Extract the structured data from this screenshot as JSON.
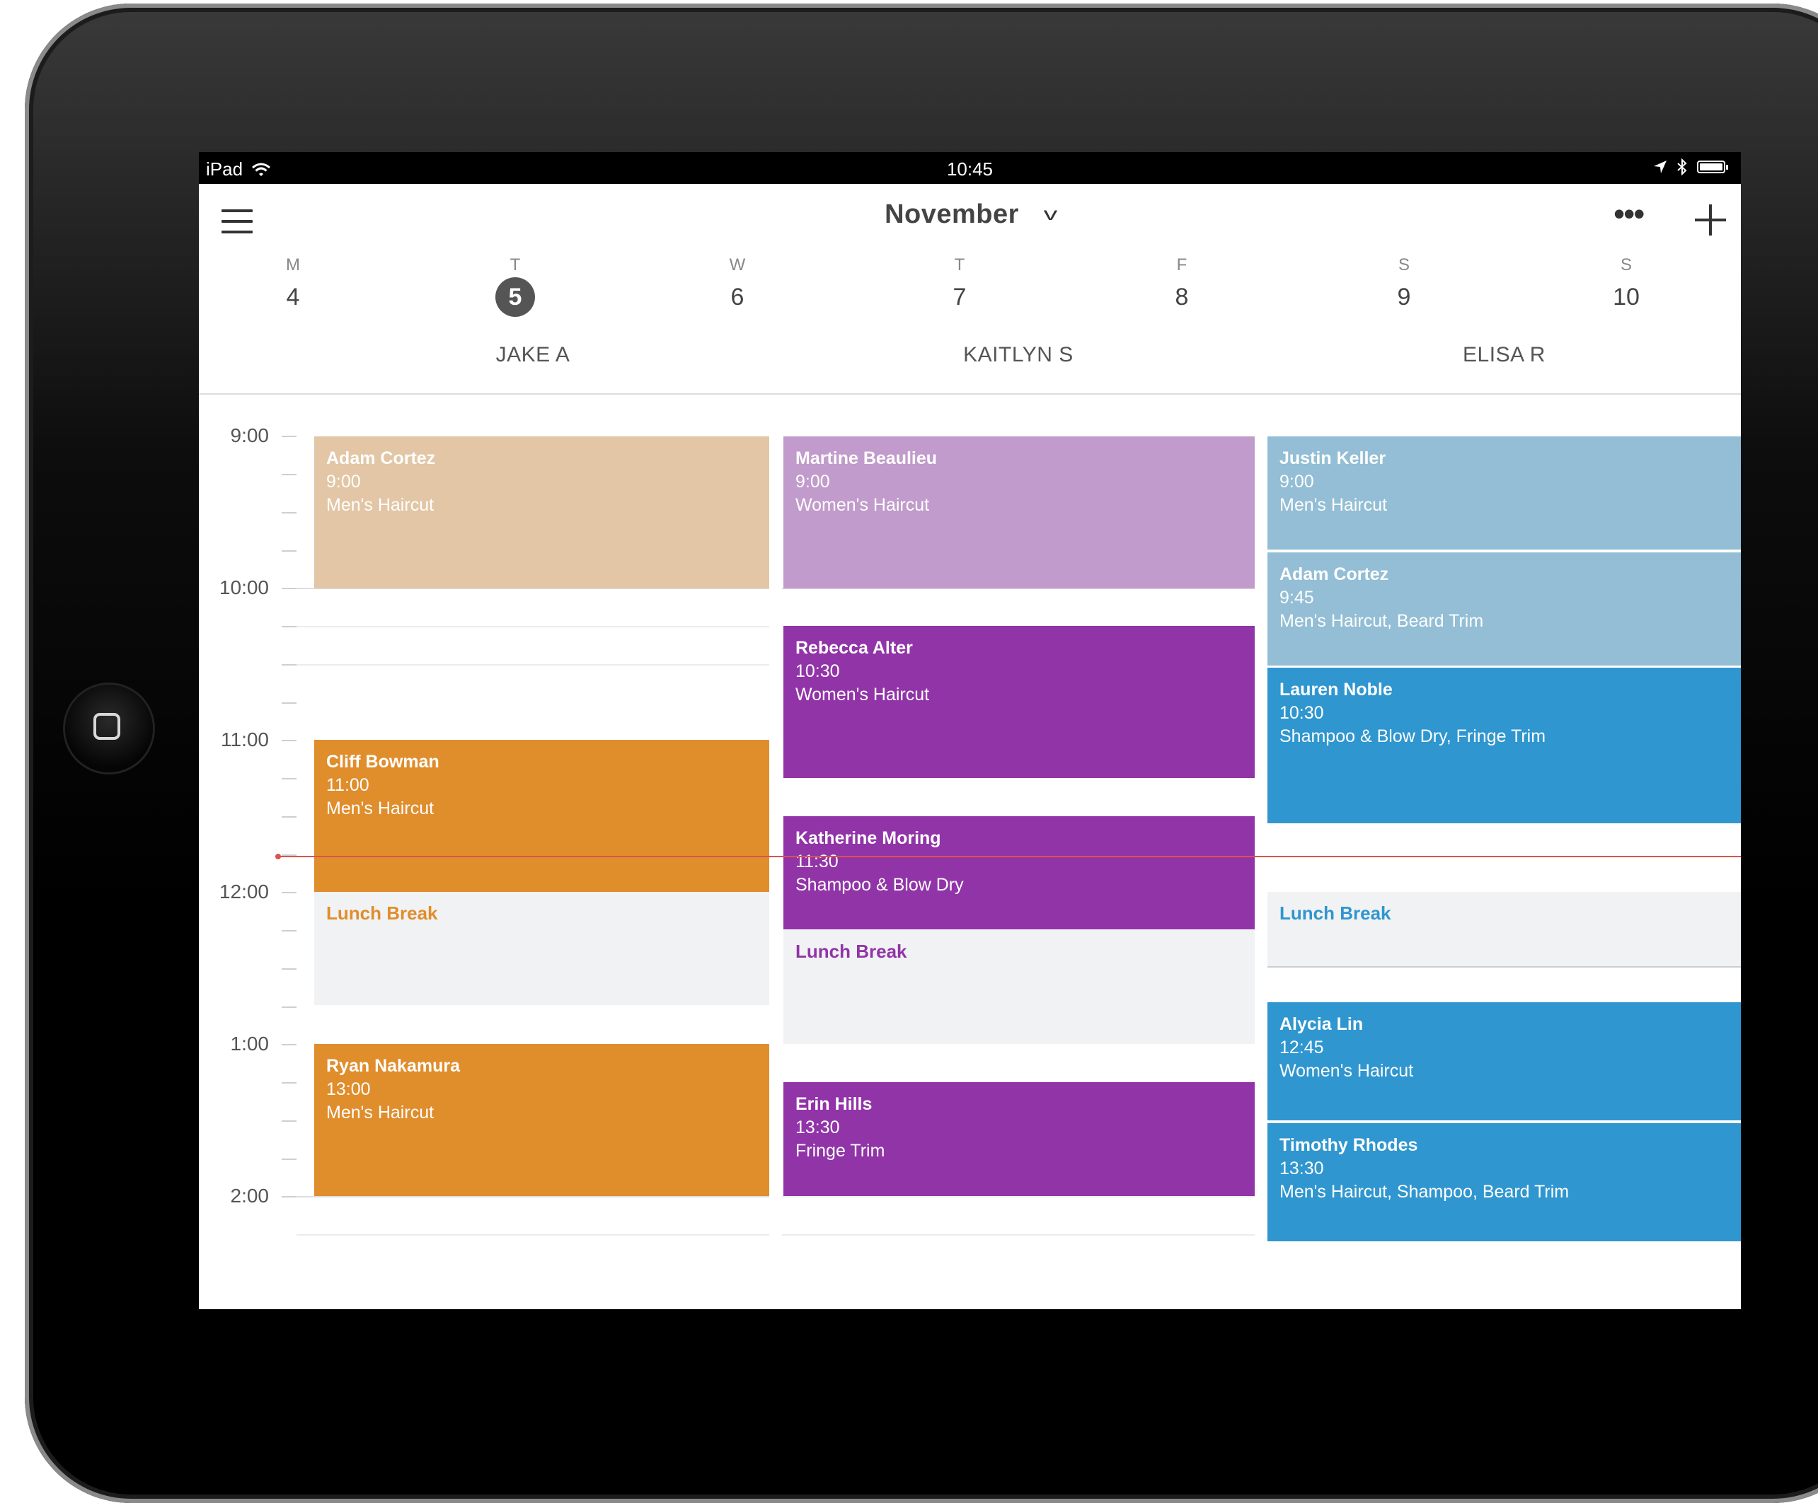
{
  "status_bar": {
    "device": "iPad",
    "time": "10:45"
  },
  "header": {
    "month": "November"
  },
  "week": [
    {
      "dow": "M",
      "date": "4"
    },
    {
      "dow": "T",
      "date": "5"
    },
    {
      "dow": "W",
      "date": "6"
    },
    {
      "dow": "T",
      "date": "7"
    },
    {
      "dow": "F",
      "date": "8"
    },
    {
      "dow": "S",
      "date": "9"
    },
    {
      "dow": "S",
      "date": "10"
    }
  ],
  "selected_day": "5",
  "times": [
    "9:00",
    "10:00",
    "11:00",
    "12:00",
    "1:00",
    "2:00"
  ],
  "colors": {
    "tan": "#e2c6a5",
    "lilac": "#c19bcb",
    "purple": "#9134a8",
    "orange": "#e08d2c",
    "light_blue": "#93bed5",
    "blue": "#2f96cf",
    "now_line": "#d9534f",
    "lunch_bg": "#f1f2f4"
  },
  "staff": [
    {
      "name": "JAKE A",
      "appointments": [
        {
          "client": "Adam Cortez",
          "time": "9:00",
          "service": "Men's Haircut"
        },
        {
          "client": "Cliff Bowman",
          "time": "11:00",
          "service": "Men's Haircut"
        },
        {
          "client": "Ryan Nakamura",
          "time": "13:00",
          "service": "Men's Haircut"
        }
      ],
      "break": "Lunch Break"
    },
    {
      "name": "KAITLYN S",
      "appointments": [
        {
          "client": "Martine Beaulieu",
          "time": "9:00",
          "service": "Women's Haircut"
        },
        {
          "client": "Rebecca Alter",
          "time": "10:30",
          "service": "Women's Haircut"
        },
        {
          "client": "Katherine Moring",
          "time": "11:30",
          "service": "Shampoo & Blow Dry"
        },
        {
          "client": "Erin Hills",
          "time": "13:30",
          "service": "Fringe Trim"
        }
      ],
      "break": "Lunch Break"
    },
    {
      "name": "ELISA R",
      "appointments": [
        {
          "client": "Justin Keller",
          "time": "9:00",
          "service": "Men's Haircut"
        },
        {
          "client": "Adam Cortez",
          "time": "9:45",
          "service": "Men's Haircut, Beard Trim"
        },
        {
          "client": "Lauren Noble",
          "time": "10:30",
          "service": "Shampoo & Blow Dry, Fringe Trim"
        },
        {
          "client": "Alycia Lin",
          "time": "12:45",
          "service": "Women's Haircut"
        },
        {
          "client": "Timothy Rhodes",
          "time": "13:30",
          "service": "Men's Haircut, Shampoo, Beard Trim"
        }
      ],
      "break": "Lunch Break"
    }
  ]
}
